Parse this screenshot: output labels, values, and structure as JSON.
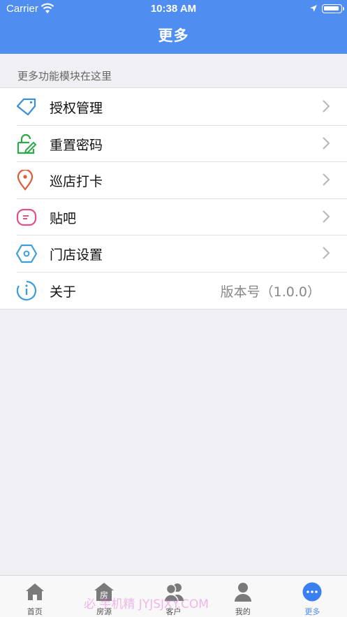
{
  "status_bar": {
    "carrier": "Carrier",
    "time": "10:38 AM"
  },
  "header": {
    "title": "更多"
  },
  "section_hint": "更多功能模块在这里",
  "menu": [
    {
      "label": "授权管理",
      "icon": "tag-icon",
      "color": "#3a8fd8"
    },
    {
      "label": "重置密码",
      "icon": "unlock-edit-icon",
      "color": "#2aa84a"
    },
    {
      "label": "巡店打卡",
      "icon": "location-pin-icon",
      "color": "#e05a3a"
    },
    {
      "label": "贴吧",
      "icon": "message-icon",
      "color": "#e0508a"
    },
    {
      "label": "门店设置",
      "icon": "hexagon-settings-icon",
      "color": "#3a9fd8"
    },
    {
      "label": "关于",
      "icon": "info-icon",
      "color": "#3a9fd8",
      "value": "版本号（1.0.0）"
    }
  ],
  "tabbar": [
    {
      "label": "首页",
      "icon": "home-icon"
    },
    {
      "label": "房源",
      "icon": "house-icon",
      "icon_text": "房"
    },
    {
      "label": "客户",
      "icon": "users-icon"
    },
    {
      "label": "我的",
      "icon": "user-icon"
    },
    {
      "label": "更多",
      "icon": "more-icon",
      "active": true
    }
  ],
  "watermark": "必 手机精 JYJSJXY.COM",
  "colors": {
    "accent": "#4f8ef0",
    "background": "#efeff4"
  }
}
